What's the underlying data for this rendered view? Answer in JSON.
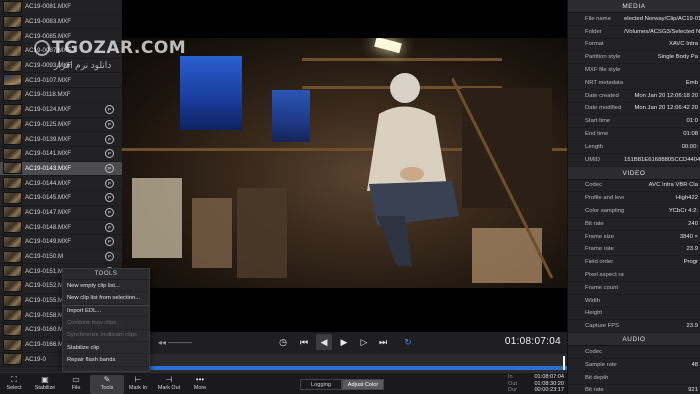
{
  "watermark": {
    "title": "TGOZAR.COM",
    "subtitle": "دانلود نرم افزار"
  },
  "clips": [
    {
      "name": "AC19-0081.MXF",
      "proxy": false,
      "thumb": 1
    },
    {
      "name": "AC19-0083.MXF",
      "proxy": false,
      "thumb": 1
    },
    {
      "name": "AC19-0085.MXF",
      "proxy": false,
      "thumb": 1
    },
    {
      "name": "AC19-0087.MXF",
      "proxy": false,
      "thumb": 1
    },
    {
      "name": "AC19-0093.MXF",
      "proxy": false,
      "thumb": 1
    },
    {
      "name": "AC19-0107.MXF",
      "proxy": false,
      "thumb": 2
    },
    {
      "name": "AC19-0118.MXF",
      "proxy": false,
      "thumb": 1
    },
    {
      "name": "AC19-0124.MXF",
      "proxy": true,
      "thumb": 1
    },
    {
      "name": "AC19-0125.MXF",
      "proxy": true,
      "thumb": 1
    },
    {
      "name": "AC19-0139.MXF",
      "proxy": true,
      "thumb": 1
    },
    {
      "name": "AC19-0141.MXF",
      "proxy": true,
      "thumb": 1
    },
    {
      "name": "AC19-0143.MXF",
      "proxy": true,
      "thumb": 1,
      "selected": true
    },
    {
      "name": "AC19-0144.MXF",
      "proxy": true,
      "thumb": 1
    },
    {
      "name": "AC19-0145.MXF",
      "proxy": true,
      "thumb": 1
    },
    {
      "name": "AC19-0147.MXF",
      "proxy": true,
      "thumb": 1
    },
    {
      "name": "AC19-0148.MXF",
      "proxy": true,
      "thumb": 1
    },
    {
      "name": "AC19-0149.MXF",
      "proxy": true,
      "thumb": 1
    },
    {
      "name": "AC19-0150.M",
      "proxy": true,
      "thumb": 1
    },
    {
      "name": "AC19-0151.M",
      "proxy": true,
      "thumb": 1
    },
    {
      "name": "AC19-0152.M",
      "proxy": true,
      "thumb": 1
    },
    {
      "name": "AC19-0155.M",
      "proxy": true,
      "thumb": 1
    },
    {
      "name": "AC19-0158.M",
      "proxy": true,
      "thumb": 1
    },
    {
      "name": "AC19-0160.M",
      "proxy": true,
      "thumb": 1
    },
    {
      "name": "AC19-0166.M",
      "proxy": true,
      "thumb": 1
    },
    {
      "name": "AC19-0",
      "proxy": true,
      "thumb": 1
    }
  ],
  "proxy_badge": "P",
  "tools_menu": {
    "title": "TOOLS",
    "items": [
      {
        "label": "New empty clip list...",
        "enabled": true
      },
      {
        "label": "New clip list from selection...",
        "enabled": true
      },
      {
        "label": "Import EDL...",
        "enabled": true,
        "separator": true
      },
      {
        "label": "Combine mov clips...",
        "enabled": false
      },
      {
        "label": "Synchronize multicam clips",
        "enabled": false
      },
      {
        "label": "Stabilize clip",
        "enabled": true
      },
      {
        "label": "Repair flash bands",
        "enabled": true
      }
    ]
  },
  "transport": {
    "timecode": "01:08:07:04"
  },
  "toolbar": {
    "buttons": [
      {
        "label": "Select",
        "icon": "select-icon",
        "glyph": "⛶"
      },
      {
        "label": "Stabilize",
        "icon": "stabilize-icon",
        "glyph": "▣"
      },
      {
        "label": "File",
        "icon": "file-icon",
        "glyph": "▭"
      },
      {
        "label": "Tools",
        "icon": "tools-icon",
        "glyph": "✎",
        "selected": true
      },
      {
        "label": "Mark In",
        "icon": "mark-in-icon",
        "glyph": "⊢"
      },
      {
        "label": "Mark Out",
        "icon": "mark-out-icon",
        "glyph": "⊣"
      },
      {
        "label": "More",
        "icon": "more-icon",
        "glyph": "•••"
      }
    ],
    "segments": [
      {
        "label": "Logging",
        "active": false
      },
      {
        "label": "Adjust Color",
        "active": true
      }
    ],
    "timecodes": [
      {
        "label": "In",
        "value": "01:08:07:04"
      },
      {
        "label": "Out",
        "value": "01:08:30:20"
      },
      {
        "label": "Dur",
        "value": "00:00:23:17"
      }
    ]
  },
  "metadata": {
    "sections": [
      {
        "title": "MEDIA",
        "rows": [
          {
            "key": "File name",
            "value": "elected Norway/Clip/AC19-014"
          },
          {
            "key": "Folder",
            "value": "/Volumes/ACSG3/Selected Norwa"
          },
          {
            "key": "Format",
            "value": "XAVC Intra"
          },
          {
            "key": "Partition style",
            "value": "Single Body Pa"
          },
          {
            "key": "MXF file style",
            "value": ""
          },
          {
            "key": "NRT metadata",
            "value": "Emb"
          },
          {
            "key": "Date created",
            "value": "Mon Jan 20 12:06:18 20"
          },
          {
            "key": "Date modified",
            "value": "Mon Jan 20 12:06:42 20"
          },
          {
            "key": "Start time",
            "value": "01:0"
          },
          {
            "key": "End time",
            "value": "01:08"
          },
          {
            "key": "Length",
            "value": "00:00:"
          },
          {
            "key": "UMID",
            "value": "151B81E61688805CCD4404A4FFEA"
          }
        ]
      },
      {
        "title": "VIDEO",
        "rows": [
          {
            "key": "Codec",
            "value": "AVC Intra VBR Cla"
          },
          {
            "key": "Profile and level",
            "value": "High422"
          },
          {
            "key": "Color sampling",
            "value": "YCbCr 4:2:"
          },
          {
            "key": "Bit rate",
            "value": "240"
          },
          {
            "key": "Frame size",
            "value": "3840 ×"
          },
          {
            "key": "Frame rate",
            "value": "23.9"
          },
          {
            "key": "Field order",
            "value": "Progr"
          },
          {
            "key": "Pixel aspect ratio",
            "value": ""
          },
          {
            "key": "Frame count",
            "value": ""
          },
          {
            "key": "Width",
            "value": ""
          },
          {
            "key": "Height",
            "value": ""
          },
          {
            "key": "Capture FPS",
            "value": "23.9"
          }
        ]
      },
      {
        "title": "AUDIO",
        "rows": [
          {
            "key": "Codec",
            "value": ""
          },
          {
            "key": "Sample rate",
            "value": "48"
          },
          {
            "key": "Bit depth",
            "value": ""
          },
          {
            "key": "Bit rate",
            "value": "921"
          }
        ]
      }
    ]
  }
}
